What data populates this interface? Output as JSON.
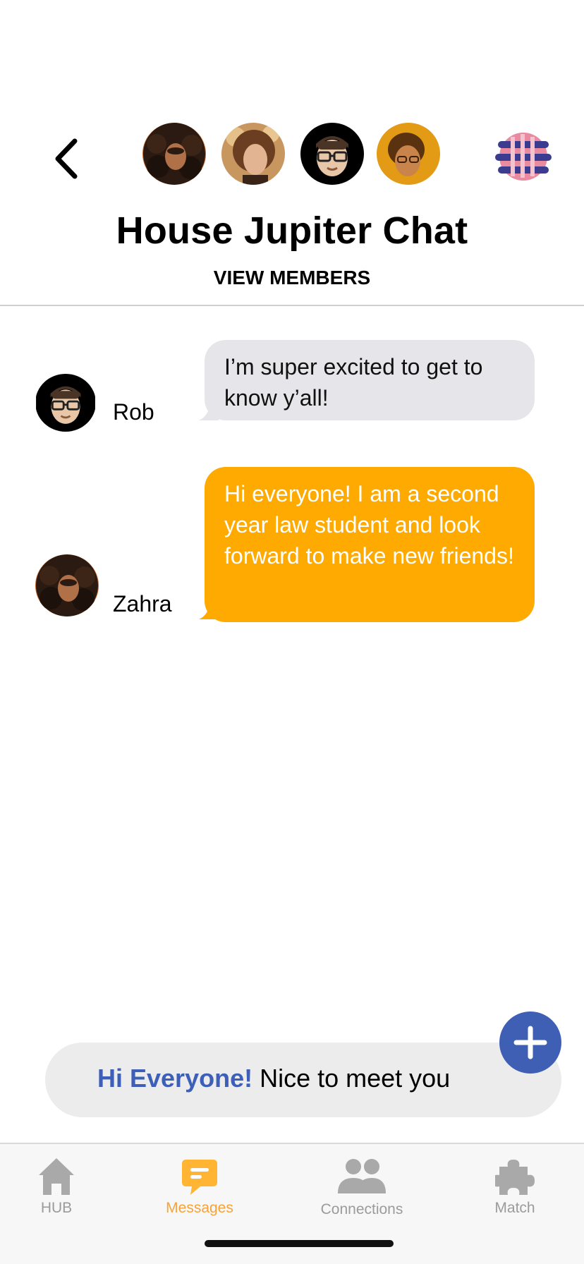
{
  "header": {
    "title": "House Jupiter Chat",
    "view_members_label": "VIEW MEMBERS",
    "back_icon": "chevron-left-icon",
    "member_avatars": [
      "zahra-avatar",
      "member-avatar-2",
      "rob-avatar",
      "member-avatar-4"
    ],
    "group_logo": "house-jupiter-logo"
  },
  "messages": [
    {
      "sender": "Rob",
      "avatar": "rob-avatar",
      "text": "I’m super excited to get to know y’all!",
      "style": "gray"
    },
    {
      "sender": "Zahra",
      "avatar": "zahra-avatar",
      "text": "Hi everyone! I am a second year law student and look forward to make new friends!",
      "style": "orange"
    }
  ],
  "composer": {
    "highlight": "Hi Everyone!",
    "text": " Nice to meet you",
    "add_icon": "plus-icon"
  },
  "tabs": [
    {
      "label": "HUB",
      "icon": "home-icon",
      "active": false
    },
    {
      "label": "Messages",
      "icon": "chat-bubble-icon",
      "active": true
    },
    {
      "label": "Connections",
      "icon": "people-icon",
      "active": false
    },
    {
      "label": "Match",
      "icon": "puzzle-icon",
      "active": false
    }
  ],
  "colors": {
    "accent_orange": "#ffaa00",
    "accent_blue": "#3f5fb5",
    "bubble_gray": "#e5e5ea",
    "tab_active": "#f5a33a",
    "tab_inactive": "#9b9b9b"
  }
}
